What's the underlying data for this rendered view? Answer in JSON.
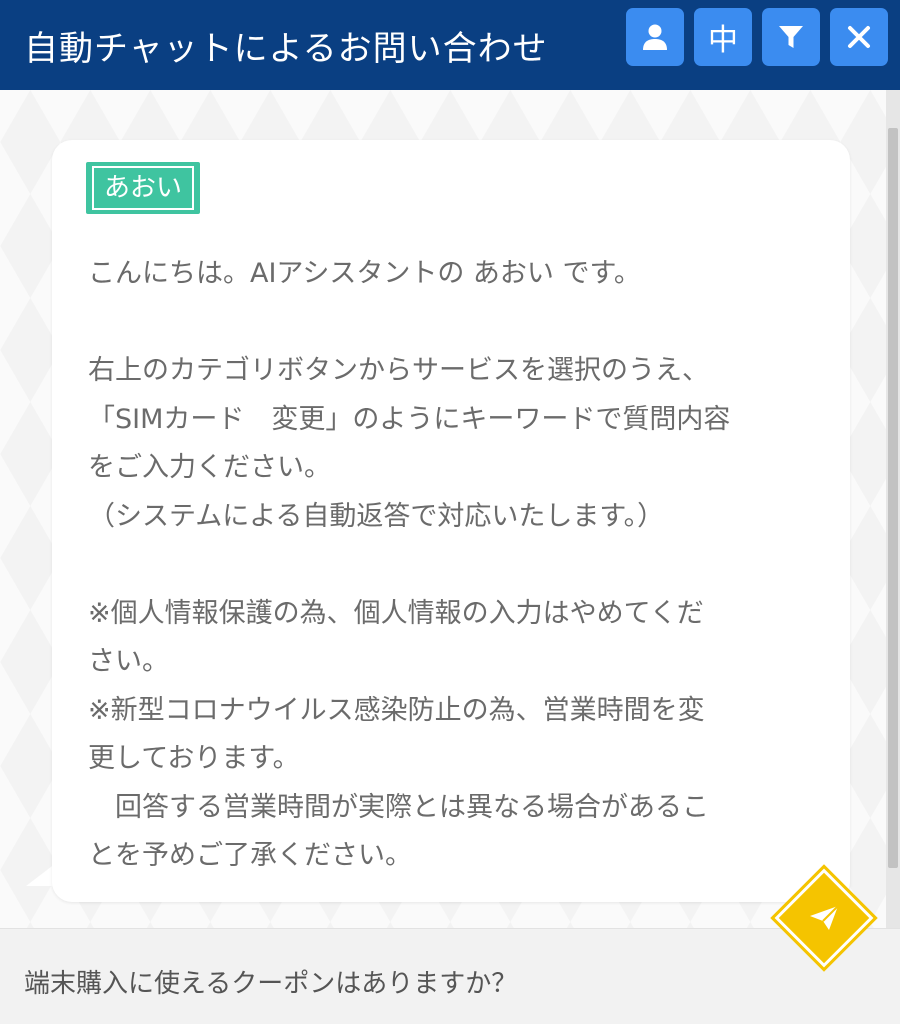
{
  "header": {
    "title": "自動チャットによるお問い合わせ",
    "buttons": [
      {
        "name": "user-icon"
      },
      {
        "name": "language-toggle",
        "label": "中"
      },
      {
        "name": "filter-icon"
      },
      {
        "name": "close-icon"
      }
    ]
  },
  "message": {
    "sender": "あおい",
    "lines": [
      "こんにちは。AIアシスタントの あおい です。",
      "",
      "右上のカテゴリボタンからサービスを選択のうえ、",
      "「SIMカード　変更」のようにキーワードで質問内容",
      "をご入力ください。",
      "（システムによる自動返答で対応いたします。）",
      "",
      "※個人情報保護の為、個人情報の入力はやめてくだ",
      "さい。",
      "※新型コロナウイルス感染防止の為、営業時間を変",
      "更しております。",
      "　回答する営業時間が実際とは異なる場合があるこ",
      "とを予めご了承ください。"
    ]
  },
  "input": {
    "value": "端末購入に使えるクーポンはありますか？"
  },
  "colors": {
    "header_bg": "#0a3f82",
    "header_button": "#3b8cf0",
    "badge": "#3fc4a0",
    "send": "#f5c400"
  }
}
